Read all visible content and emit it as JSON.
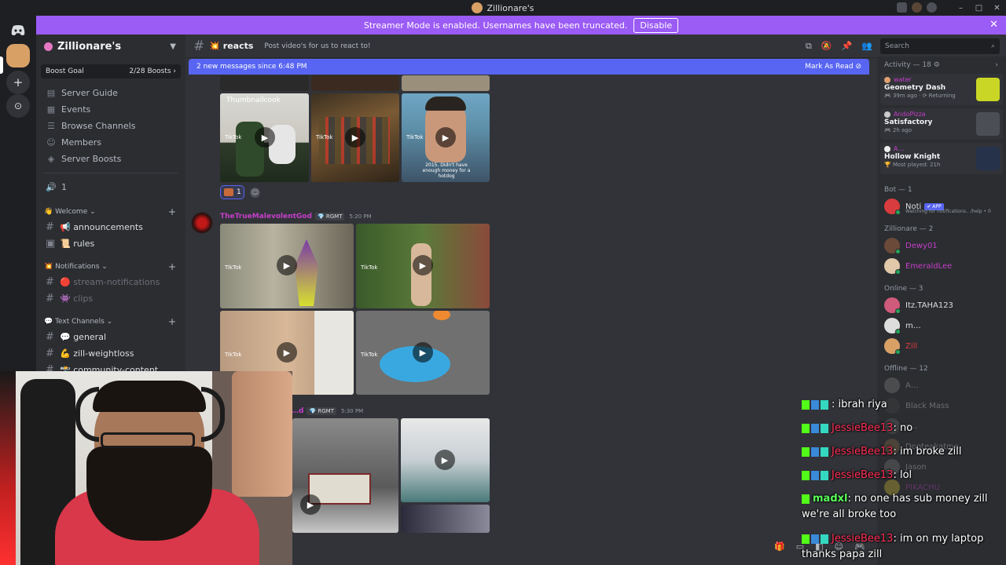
{
  "window": {
    "title": "Zillionare's",
    "minimize": "–",
    "maximize": "□",
    "close": "✕"
  },
  "banner": {
    "text": "Streamer Mode is enabled. Usernames have been truncated.",
    "button": "Disable",
    "close": "✕"
  },
  "server": {
    "name": "Zillionare's",
    "boost_label": "Boost Goal",
    "boost_count": "2/28 Boosts ›",
    "nav": [
      {
        "label": "Server Guide",
        "icon": "guide-icon"
      },
      {
        "label": "Events",
        "icon": "calendar-icon"
      },
      {
        "label": "Browse Channels",
        "icon": "browse-icon"
      },
      {
        "label": "Members",
        "icon": "members-icon"
      },
      {
        "label": "Server Boosts",
        "icon": "boost-icon"
      }
    ],
    "voice_label": "1",
    "categories": [
      {
        "name": "👋 Welcome ⌄",
        "channels": [
          "📢 announcements",
          "📜 rules"
        ]
      },
      {
        "name": "💥 Notifications ⌄",
        "channels": [
          "🔴 stream-notifications",
          "👾 clips"
        ]
      },
      {
        "name": "💬 Text Channels ⌄",
        "channels": [
          "💬 general",
          "💪 zill-weightloss",
          "📸 community-content"
        ]
      }
    ]
  },
  "channel": {
    "name": "💥 reacts",
    "topic": "Post video's for us to react to!",
    "new_messages": "2 new messages since 6:48 PM",
    "mark_read": "Mark As Read"
  },
  "search": {
    "placeholder": "Search"
  },
  "messages": [
    {
      "reaction_count": "1",
      "thumb_captions": [
        "Thumbnailcook",
        "2015. Didn't have enough money for a hotdog"
      ]
    },
    {
      "author": "TheTrueMalevolentGod",
      "tag": "💎 RGMT",
      "time": "5:20 PM"
    },
    {
      "author": "…d",
      "tag": "💎 RGMT",
      "time": "5:30 PM"
    }
  ],
  "tiktok_label": "TikTok",
  "members": {
    "activity_header": "Activity — 18 ⚙",
    "activities": [
      {
        "user": "water",
        "game": "Geometry Dash",
        "meta": "🎮 39m ago · ⟳ Returning",
        "art_color": "#c9d625"
      },
      {
        "user": "AndoPizza",
        "game": "Satisfactory",
        "meta": "🎮 2h ago",
        "art_color": "#4b4f55"
      },
      {
        "user": "A…",
        "game": "Hollow Knight",
        "meta": "🏆 Most played: 21h",
        "art_color": "#26324a"
      }
    ],
    "groups": [
      {
        "title": "Bot — 1",
        "members": [
          {
            "name": "Noti",
            "badge": "✔ APP",
            "status": "Watching for notifications.. /help • 0",
            "color": "#dbdee1",
            "av": "#d83c3e"
          }
        ]
      },
      {
        "title": "Zillionare — 2",
        "members": [
          {
            "name": "Dewy01",
            "color": "#c63eca",
            "av": "#6b4a3a"
          },
          {
            "name": "EmeraldLee",
            "color": "#c63eca",
            "av": "#e0c8a8"
          }
        ]
      },
      {
        "title": "Online — 3",
        "members": [
          {
            "name": "Itz.TAHA123",
            "color": "#dbdee1",
            "av": "#d05a7a"
          },
          {
            "name": "m…",
            "color": "#dbdee1",
            "av": "#ddd"
          },
          {
            "name": "Zill",
            "color": "#d83c3e",
            "av": "#d9a066"
          }
        ]
      },
      {
        "title": "Offline — 12",
        "members": [
          {
            "name": "A…",
            "color": "#dbdee1",
            "av": "#888"
          },
          {
            "name": "Black Mass",
            "color": "#dbdee1",
            "av": "#444"
          },
          {
            "name": "c…",
            "color": "#dbdee1",
            "av": "#666"
          },
          {
            "name": "Donteakatme",
            "color": "#dbdee1",
            "av": "#8a6d4a"
          },
          {
            "name": "Jason",
            "color": "#dbdee1",
            "av": "#777"
          },
          {
            "name": "PIKACHU",
            "color": "#c63eca",
            "av": "#d8c030"
          }
        ]
      }
    ]
  },
  "stream_chat": [
    {
      "user": "",
      "text": ": ibrah riya"
    },
    {
      "user": "JessieBee13",
      "text": ": no"
    },
    {
      "user": "JessieBee13",
      "text": ": im broke zill"
    },
    {
      "user": "JessieBee13",
      "text": ": lol"
    },
    {
      "user": "madxl",
      "text": ": no one has sub money zill"
    },
    {
      "user": "",
      "text": "we're all broke too"
    },
    {
      "user": "JessieBee13",
      "text": ": im on my laptop"
    },
    {
      "user": "",
      "text": "thanks papa zill"
    }
  ],
  "colors": {
    "accent": "#5865f2",
    "banner": "#9b5bf5",
    "chat_user": "#ff2d55",
    "chat_user_alt": "#58ff58"
  }
}
